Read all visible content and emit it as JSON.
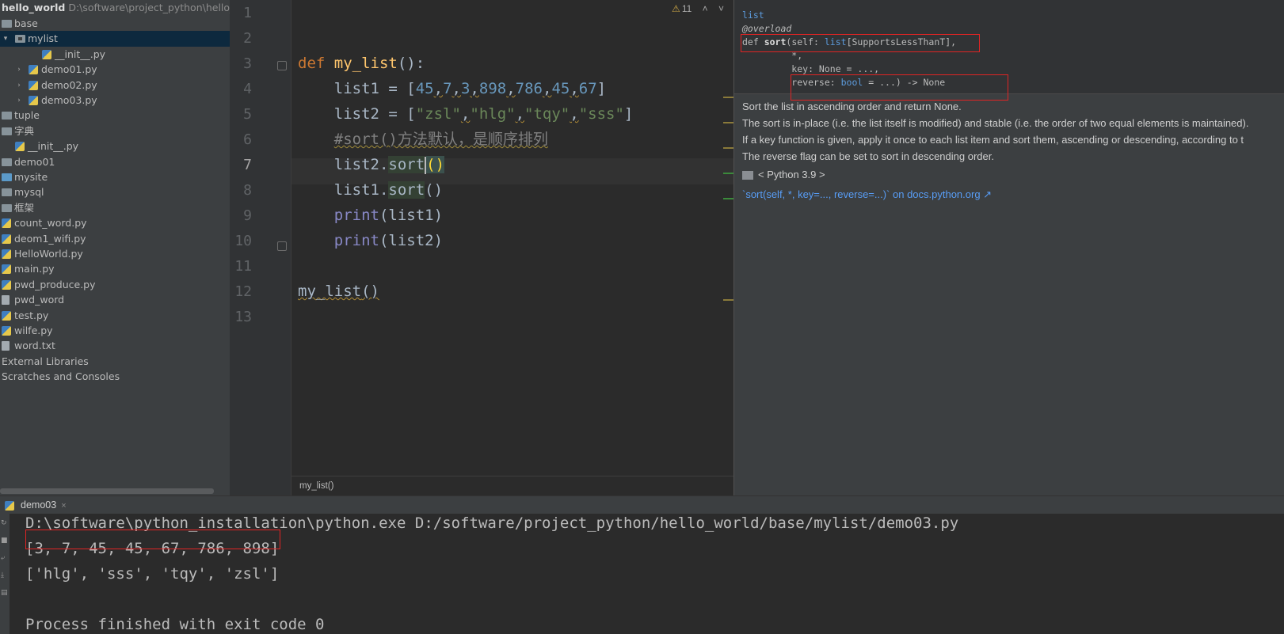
{
  "project": {
    "root_name": "hello_world",
    "root_path": "D:\\software\\project_python\\hello_wo",
    "items": [
      {
        "label": "base",
        "kind": "folder"
      },
      {
        "label": "mylist",
        "kind": "package"
      },
      {
        "label": "__init__.py",
        "kind": "py"
      },
      {
        "label": "demo01.py",
        "kind": "py"
      },
      {
        "label": "demo02.py",
        "kind": "py"
      },
      {
        "label": "demo03.py",
        "kind": "py"
      },
      {
        "label": "tuple",
        "kind": "folder"
      },
      {
        "label": "字典",
        "kind": "folder"
      },
      {
        "label": "__init__.py",
        "kind": "py"
      },
      {
        "label": "demo01",
        "kind": "folder"
      },
      {
        "label": "mysite",
        "kind": "folder-blue"
      },
      {
        "label": "mysql",
        "kind": "folder"
      },
      {
        "label": "框架",
        "kind": "folder"
      },
      {
        "label": "count_word.py",
        "kind": "py"
      },
      {
        "label": "deom1_wifi.py",
        "kind": "py"
      },
      {
        "label": "HelloWorld.py",
        "kind": "py"
      },
      {
        "label": "main.py",
        "kind": "py"
      },
      {
        "label": "pwd_produce.py",
        "kind": "py"
      },
      {
        "label": "pwd_word",
        "kind": "txt"
      },
      {
        "label": "test.py",
        "kind": "py"
      },
      {
        "label": "wilfe.py",
        "kind": "py"
      },
      {
        "label": "word.txt",
        "kind": "txt"
      },
      {
        "label": "External Libraries",
        "kind": "lib"
      },
      {
        "label": "Scratches and Consoles",
        "kind": "lib"
      }
    ]
  },
  "editor": {
    "line_numbers": [
      "1",
      "2",
      "3",
      "4",
      "5",
      "6",
      "7",
      "8",
      "9",
      "10",
      "11",
      "12",
      "13"
    ],
    "warning_count": "11",
    "breadcrumb": "my_list()",
    "code": {
      "l3_def": "def",
      "l3_name": "my_list",
      "l3_rest": "():",
      "l4_var": "list1 = [",
      "l4_nums": [
        "45",
        "7",
        "3",
        "898",
        "786",
        "45",
        "67"
      ],
      "l4_end": "]",
      "l5_var": "list2 = [",
      "l5_strs": [
        "\"zsl\"",
        "\"hlg\"",
        "\"tqy\"",
        "\"sss\""
      ],
      "l5_end": "]",
      "l6_comment": "#sort()方法默认，是顺序排列",
      "l7_obj": "list2.",
      "l7_meth": "sort",
      "l7_paren": "()",
      "l8_obj": "list1.",
      "l8_meth": "sort",
      "l8_paren": "()",
      "l9_fn": "print",
      "l9_arg": "(list1)",
      "l10_fn": "print",
      "l10_arg": "(list2)",
      "l12_call": "my_list",
      "l12_paren": "()",
      "comma": ","
    }
  },
  "doc": {
    "sig": {
      "l1": "list",
      "l2": "@overload",
      "l3_def": "def ",
      "l3_name": "sort",
      "l3_a": "(self: ",
      "l3_type": "list",
      "l3_b": "[SupportsLessThanT],",
      "l4": "         *,",
      "l5": "         key: None = ...,",
      "l6_a": "         reverse: ",
      "l6_type": "bool",
      "l6_b": " = ...) -> None"
    },
    "text": [
      "Sort the list in ascending order and return None.",
      "The sort is in-place (i.e. the list itself is modified) and stable (i.e. the order of two equal elements is maintained).",
      "If a key function is given, apply it once to each list item and sort them, ascending or descending, according to t",
      "The reverse flag can be set to sort in descending order."
    ],
    "library": "< Python 3.9 >",
    "link": "`sort(self, *, key=..., reverse=...)` on docs.python.org ↗"
  },
  "run": {
    "tab_label": "demo03",
    "close": "×",
    "lines": [
      "D:\\software\\python_installation\\python.exe D:/software/project_python/hello_world/base/mylist/demo03.py",
      "[3, 7, 45, 45, 67, 786, 898]",
      "['hlg', 'sss', 'tqy', 'zsl']",
      "",
      "Process finished with exit code 0"
    ]
  },
  "colors": {
    "keyword": "#cc7832",
    "function": "#ffc66d",
    "number": "#6897bb",
    "string": "#6a8759",
    "comment": "#808080",
    "builtin": "#8888c6",
    "highlight_box": "#e02424"
  }
}
